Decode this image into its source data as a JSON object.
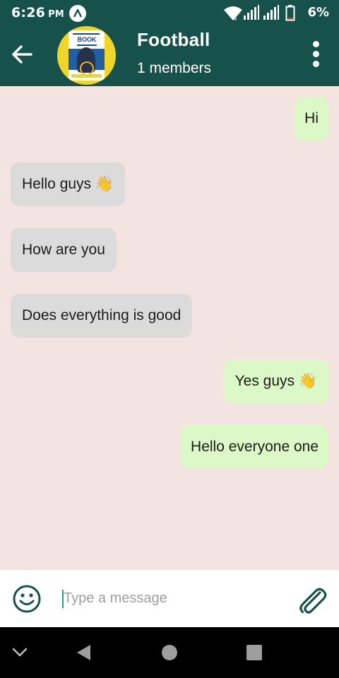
{
  "status_bar": {
    "time": "6:26",
    "ampm": "PM",
    "battery_percent": "6%"
  },
  "header": {
    "title": "Football",
    "subtitle": "1 members",
    "avatar_poster_text": "BOOK"
  },
  "messages": [
    {
      "direction": "out",
      "text": "Hi"
    },
    {
      "direction": "in",
      "text": "Hello guys 👋"
    },
    {
      "direction": "in",
      "text": "How are you"
    },
    {
      "direction": "in",
      "text": "Does everything is good"
    },
    {
      "direction": "out",
      "text": "Yes guys 👋"
    },
    {
      "direction": "out",
      "text": "Hello everyone one"
    }
  ],
  "composer": {
    "placeholder": "Type a message",
    "value": ""
  },
  "icons": {
    "back": "arrow-left-icon",
    "menu": "more-vert-icon",
    "emoji": "smiley-icon",
    "attach": "paperclip-icon"
  },
  "colors": {
    "header_bg": "#17514c",
    "chat_bg": "#f3e4e2",
    "incoming_bubble": "#dbdbdb",
    "outgoing_bubble": "#dcf8c6",
    "accent": "#1aa39a"
  }
}
